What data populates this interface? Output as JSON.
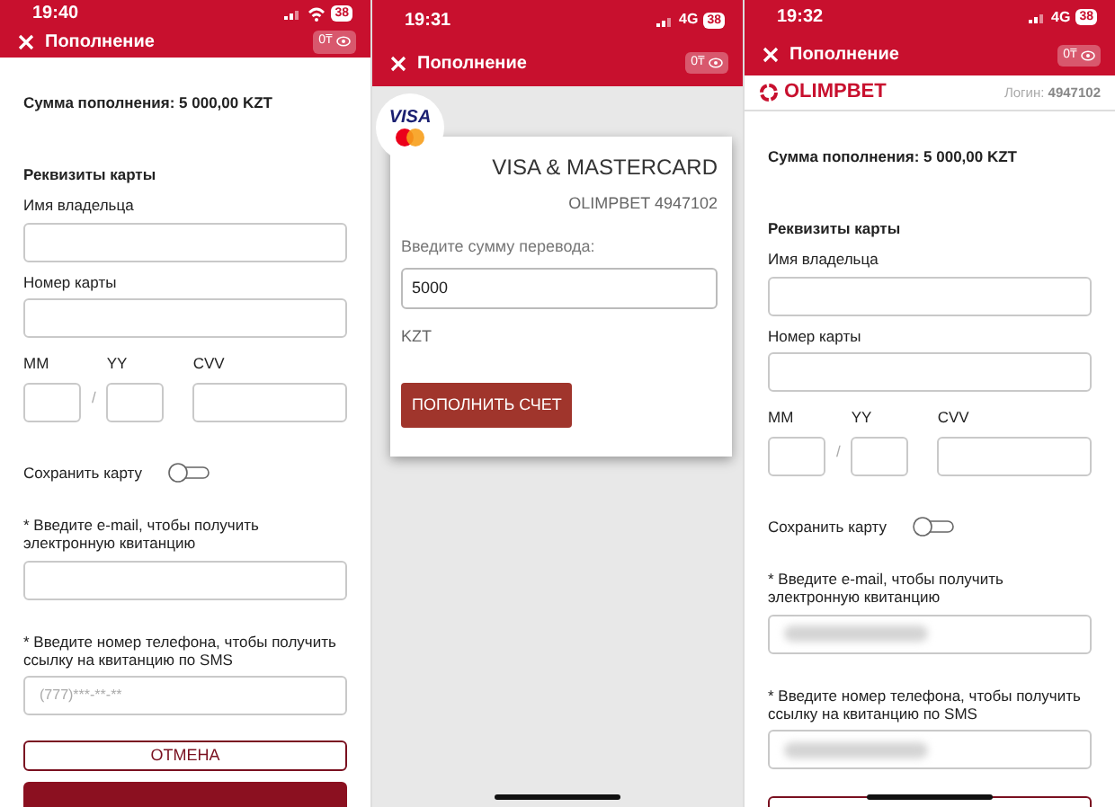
{
  "screens": [
    {
      "kind": "form",
      "status": {
        "time": "19:40",
        "wifi": true,
        "battery": "38"
      },
      "header": {
        "title": "Пополнение",
        "balance": "0₸"
      },
      "summary": "Сумма пополнения: 5 000,00 KZT",
      "section": "Реквизиты карты",
      "items": [
        {
          "kind": "field",
          "label": "Имя владельца"
        },
        {
          "kind": "field",
          "label": "Номер карты"
        },
        {
          "kind": "expiry",
          "labels": [
            "MM",
            "YY",
            "CVV"
          ],
          "separator": "/"
        },
        {
          "kind": "toggle",
          "label": "Сохранить карту",
          "on": false
        },
        {
          "kind": "field",
          "label": "* Введите e-mail, чтобы получить электронную квитанцию"
        },
        {
          "kind": "field",
          "label": "* Введите номер телефона, чтобы получить ссылку на квитанцию по SMS",
          "placeholder": "(777)***-**-**"
        }
      ],
      "buttons": [
        {
          "kind": "outline",
          "label": "ОТМЕНА"
        },
        {
          "kind": "filled"
        }
      ]
    },
    {
      "kind": "card",
      "status": {
        "time": "19:31",
        "network": "4G",
        "battery": "38"
      },
      "header": {
        "title": "Пополнение",
        "balance": "0₸"
      },
      "logo": "VISA",
      "title": "VISA & MASTERCARD",
      "account": "OLIMPBET 4947102",
      "amount_label": "Введите сумму перевода:",
      "amount": "5000",
      "currency": "KZT",
      "submit": "ПОПОЛНИТЬ СЧЕТ",
      "home_indicator": true
    },
    {
      "kind": "form",
      "status": {
        "time": "19:32",
        "network": "4G",
        "battery": "38"
      },
      "header": {
        "title": "Пополнение",
        "balance": "0₸"
      },
      "brand": {
        "name": "OLIMPBET",
        "login_label": "Логин:",
        "login": "4947102"
      },
      "summary": "Сумма пополнения: 5 000,00 KZT",
      "section": "Реквизиты карты",
      "items": [
        {
          "kind": "field",
          "label": "Имя владельца"
        },
        {
          "kind": "field",
          "label": "Номер карты"
        },
        {
          "kind": "expiry",
          "labels": [
            "MM",
            "YY",
            "CVV"
          ],
          "separator": "/"
        },
        {
          "kind": "toggle",
          "label": "Сохранить карту",
          "on": false
        },
        {
          "kind": "field",
          "label": "* Введите e-mail, чтобы получить электронную квитанцию",
          "redacted": true
        },
        {
          "kind": "field",
          "label": "* Введите номер телефона, чтобы получить ссылку на квитанцию по SMS",
          "redacted": true
        }
      ],
      "buttons": [
        {
          "kind": "outline"
        }
      ],
      "home_indicator": true
    }
  ]
}
